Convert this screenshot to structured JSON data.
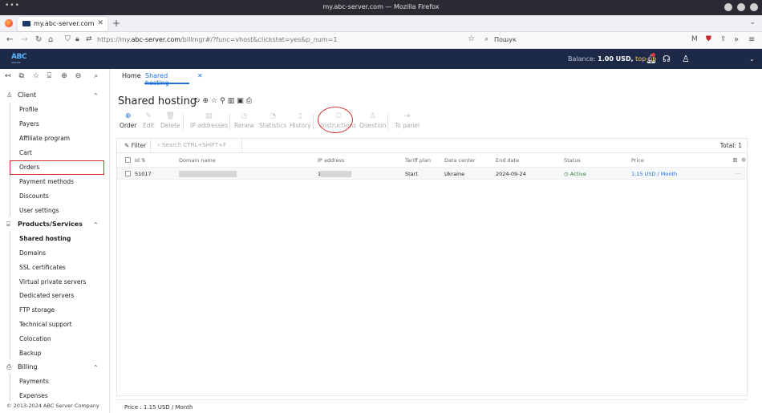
{
  "browser": {
    "window_title": "my.abc-server.com — Mozilla Firefox",
    "tab_title": "my.abc-server.com",
    "url_prefix": "https://my.",
    "url_domain": "abc-server.com",
    "url_path": "/billmgr#/?func=vhost&clickstat=yes&p_num=1",
    "search_placeholder": "Пошук"
  },
  "header": {
    "logo_text": "ABC",
    "logo_sub": "SERVER",
    "balance_label": "Balance:",
    "balance_value": "1.00 USD,",
    "topup_label": "top-up"
  },
  "sidebar": {
    "sections": [
      {
        "label": "Client",
        "items": [
          "Profile",
          "Payers",
          "Affiliate program",
          "Cart",
          "Orders",
          "Payment methods",
          "Discounts",
          "User settings"
        ]
      },
      {
        "label": "Products/Services",
        "items": [
          "Shared hosting",
          "Domains",
          "SSL certificates",
          "Virtual private servers",
          "Dedicated servers",
          "FTP storage",
          "Technical support",
          "Colocation",
          "Backup"
        ]
      },
      {
        "label": "Billing",
        "items": [
          "Payments",
          "Expenses"
        ]
      }
    ],
    "copyright": "© 2013-2024 ABC Server Company"
  },
  "breadcrumb": {
    "home": "Home",
    "current": "Shared hosting"
  },
  "page": {
    "title": "Shared hosting"
  },
  "toolbar": [
    {
      "label": "Order",
      "icon": "⊕",
      "enabled": true
    },
    {
      "label": "Edit",
      "icon": "✎",
      "enabled": false
    },
    {
      "label": "Delete",
      "icon": "🗑",
      "enabled": false
    },
    {
      "label": "IP addresses",
      "icon": "▤",
      "enabled": false
    },
    {
      "label": "Renew",
      "icon": "◷",
      "enabled": false
    },
    {
      "label": "Statistics",
      "icon": "◔",
      "enabled": false
    },
    {
      "label": "History",
      "icon": "▯",
      "enabled": false
    },
    {
      "label": "Instructions",
      "icon": "⛋",
      "enabled": false
    },
    {
      "label": "Question",
      "icon": "♙",
      "enabled": false
    },
    {
      "label": "To panel",
      "icon": "⇥",
      "enabled": false
    }
  ],
  "list": {
    "filter_label": "Filter",
    "search_placeholder": "Search CTRL+SHIFT+F",
    "total": "Total: 1",
    "columns": [
      "Id",
      "Domain name",
      "IP address",
      "Tariff plan",
      "Data center",
      "End date",
      "Status",
      "Price"
    ],
    "rows": [
      {
        "id": "51017",
        "ip_prefix": "1",
        "tariff": "Start",
        "datacenter": "Ukraine",
        "end_date": "2024-09-24",
        "status": "Active",
        "price": "1.15 USD / Month"
      }
    ],
    "footer": "Price : 1.15 USD / Month"
  },
  "colors": {
    "header_bg": "#1c2a47",
    "accent": "#1e6fd9",
    "active": "#2e7d32",
    "highlight": "#d32f2f"
  }
}
